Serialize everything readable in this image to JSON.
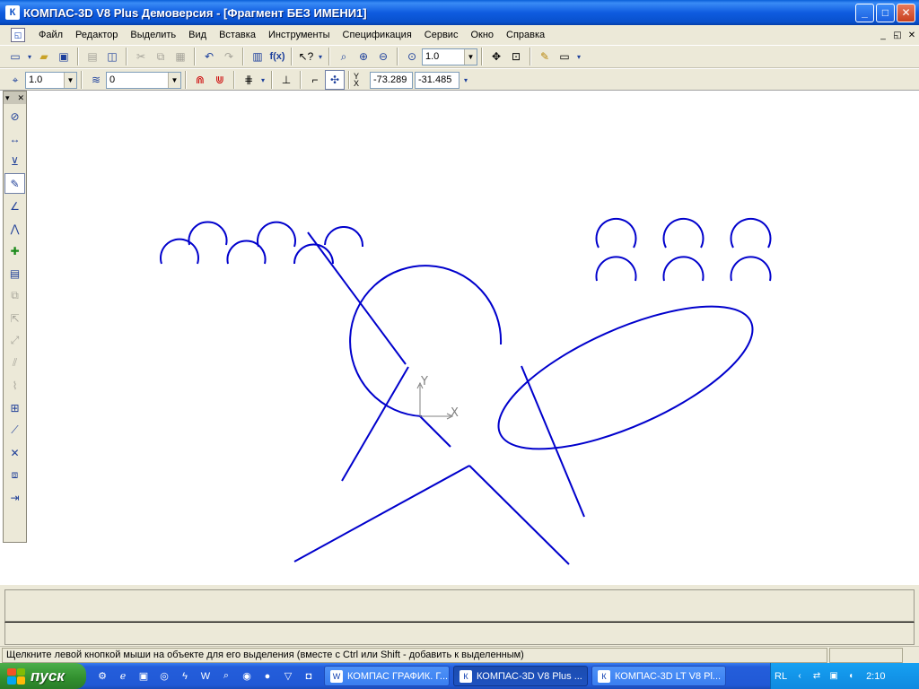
{
  "window": {
    "title": "КОМПАС-3D V8 Plus Демоверсия - [Фрагмент БЕЗ ИМЕНИ1]",
    "minimize_glyph": "_",
    "maximize_glyph": "□",
    "close_glyph": "✕"
  },
  "menu": {
    "items": [
      "Файл",
      "Редактор",
      "Выделить",
      "Вид",
      "Вставка",
      "Инструменты",
      "Спецификация",
      "Сервис",
      "Окно",
      "Справка"
    ],
    "doc_controls": [
      "_",
      "◱",
      "✕"
    ]
  },
  "toolbar1": {
    "zoom_value": "1.0"
  },
  "toolbar2": {
    "step_value": "1.0",
    "layer_value": "0",
    "x_coord": "-73.289",
    "y_coord": "-31.485",
    "coord_label_y": "Y",
    "coord_label_x": "X"
  },
  "canvas": {
    "axis_y_label": "Y",
    "axis_x_label": "X",
    "stroke_color": "#0000cc",
    "axis_color": "#808080"
  },
  "statusbar": {
    "message": "Щелкните левой кнопкой мыши на объекте для его выделения (вместе с Ctrl или Shift - добавить к выделенным)"
  },
  "taskbar": {
    "start_label": "пуск",
    "tasks": [
      {
        "label": "КОМПАС ГРАФИК. Г...",
        "state": "inactive"
      },
      {
        "label": "КОМПАС-3D V8 Plus ...",
        "state": "active"
      },
      {
        "label": "КОМПАС-3D LT V8 Pl...",
        "state": "inactive"
      }
    ],
    "tray_lang": "RL",
    "clock": "2:10"
  }
}
